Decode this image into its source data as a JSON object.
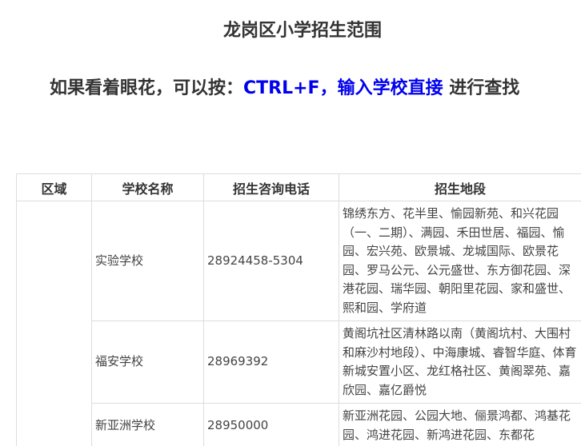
{
  "page_title": "龙岗区小学招生范围",
  "hint": {
    "prefix": "如果看着眼花，可以按：",
    "shortcut": "CTRL+F，输入学校直接",
    "suffix": " 进行查找"
  },
  "table": {
    "headers": [
      "区域",
      "学校名称",
      "招生咨询电话",
      "招生地段"
    ],
    "district": "",
    "rows": [
      {
        "school": "实验学校",
        "phone": "28924458-5304",
        "area": "锦绣东方、花半里、愉园新苑、和兴花园（一、二期）、满园、禾田世居、福园、愉园、宏兴苑、欧景城、龙城国际、欧景花园、罗马公元、公元盛世、东方御花园、深港花园、瑞华园、朝阳里花园、家和盛世、熙和园、学府道"
      },
      {
        "school": "福安学校",
        "phone": "28969392",
        "area": "黄阁坑社区清林路以南（黄阁坑村、大围村和麻沙村地段）、中海康城、睿智华庭、体育新城安置小区、龙红格社区、黄阁翠苑、嘉欣园、嘉亿爵悦"
      },
      {
        "school": "新亚洲学校",
        "phone": "28950000",
        "area": "新亚洲花园、公园大地、俪景鸿都、鸿基花园、鸿进花园、新鸿进花园、东都花"
      }
    ]
  }
}
